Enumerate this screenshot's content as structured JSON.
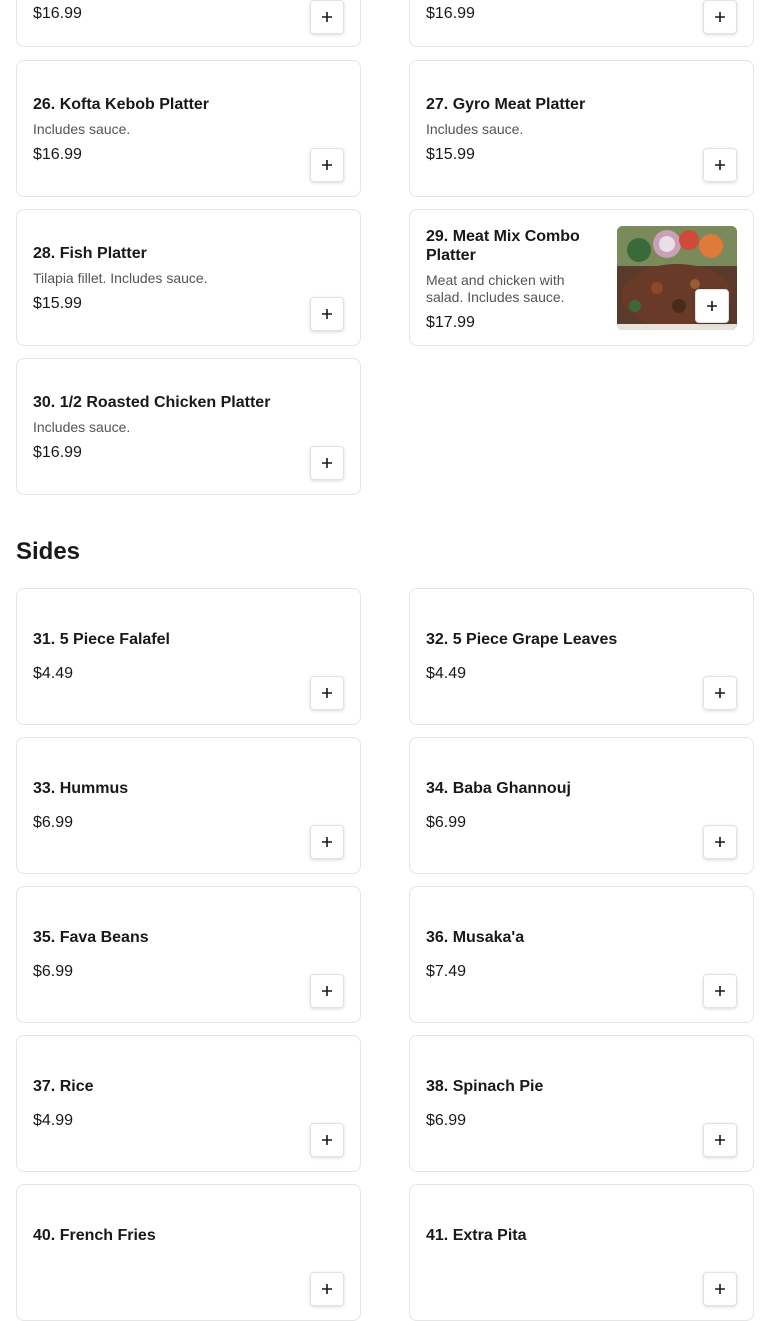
{
  "platters_top": [
    {
      "price": "$16.99"
    },
    {
      "price": "$16.99"
    }
  ],
  "platters": [
    {
      "name": "26. Kofta Kebob Platter",
      "desc": "Includes sauce.",
      "price": "$16.99"
    },
    {
      "name": "27. Gyro Meat Platter",
      "desc": "Includes sauce.",
      "price": "$15.99"
    },
    {
      "name": "28. Fish Platter",
      "desc": "Tilapia fillet. Includes sauce.",
      "price": "$15.99"
    },
    {
      "name": "29. Meat Mix Combo Platter",
      "desc": "Meat and chicken with salad. Includes sauce.",
      "price": "$17.99"
    },
    {
      "name": "30. 1/2 Roasted Chicken Platter",
      "desc": "Includes sauce.",
      "price": "$16.99"
    }
  ],
  "sides_section": {
    "title": "Sides"
  },
  "sides": [
    {
      "name": "31. 5 Piece Falafel",
      "price": "$4.49"
    },
    {
      "name": "32. 5 Piece Grape Leaves",
      "price": "$4.49"
    },
    {
      "name": "33. Hummus",
      "price": "$6.99"
    },
    {
      "name": "34. Baba Ghannouj",
      "price": "$6.99"
    },
    {
      "name": "35. Fava Beans",
      "price": "$6.99"
    },
    {
      "name": "36. Musaka'a",
      "price": "$7.49"
    },
    {
      "name": "37. Rice",
      "price": "$4.99"
    },
    {
      "name": "38. Spinach Pie",
      "price": "$6.99"
    },
    {
      "name": "40. French Fries",
      "price": ""
    },
    {
      "name": "41. Extra Pita",
      "price": ""
    }
  ],
  "icons": {
    "add": "plus-icon"
  }
}
